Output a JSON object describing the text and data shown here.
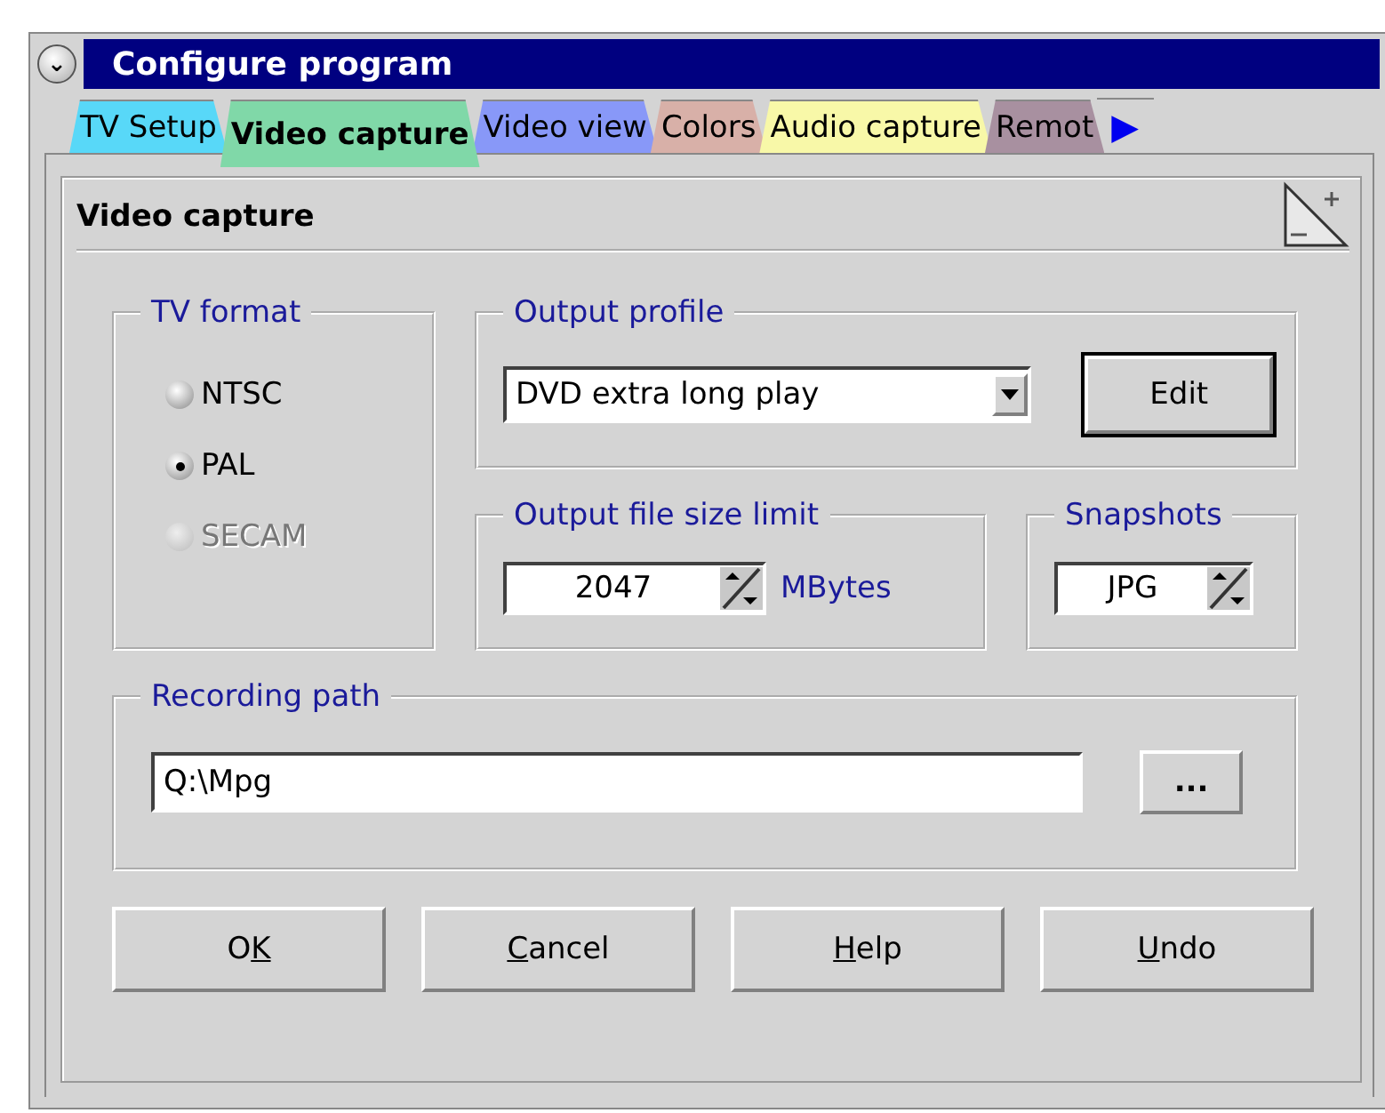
{
  "window": {
    "title": "Configure program",
    "menu_button": "⌄"
  },
  "tabs": [
    {
      "label": "TV Setup",
      "selected": false,
      "color": "#58d8f8"
    },
    {
      "label": "Video capture",
      "selected": true,
      "color": "#80d8a8"
    },
    {
      "label": "Video view",
      "selected": false,
      "color": "#8898f8"
    },
    {
      "label": "Colors",
      "selected": false,
      "color": "#d8b0a8"
    },
    {
      "label": "Audio capture",
      "selected": false,
      "color": "#f8f8a8"
    },
    {
      "label": "Remot",
      "selected": false,
      "color": "#a890a0"
    }
  ],
  "tab_scroll": "▶",
  "page_title": "Video capture",
  "tv_format": {
    "legend": "TV format",
    "options": [
      {
        "label": "NTSC",
        "selected": false,
        "disabled": false
      },
      {
        "label": "PAL",
        "selected": true,
        "disabled": false
      },
      {
        "label": "SECAM",
        "selected": false,
        "disabled": true
      }
    ]
  },
  "output_profile": {
    "legend": "Output profile",
    "value": "DVD extra long play",
    "button": "Edit"
  },
  "size_limit": {
    "legend": "Output file size limit",
    "value": "2047",
    "unit": "MBytes"
  },
  "snapshots": {
    "legend": "Snapshots",
    "value": "JPG"
  },
  "recording_path": {
    "legend": "Recording path",
    "value": "Q:\\Mpg",
    "button": "..."
  },
  "buttons": [
    {
      "parts": [
        {
          "text": "O",
          "underline": false
        },
        {
          "text": "K",
          "underline": true
        }
      ]
    },
    {
      "parts": [
        {
          "text": "C",
          "underline": true
        },
        {
          "text": "ancel",
          "underline": false
        }
      ]
    },
    {
      "parts": [
        {
          "text": "H",
          "underline": true
        },
        {
          "text": "elp",
          "underline": false
        }
      ]
    },
    {
      "parts": [
        {
          "text": "U",
          "underline": true
        },
        {
          "text": "ndo",
          "underline": false
        }
      ]
    }
  ]
}
